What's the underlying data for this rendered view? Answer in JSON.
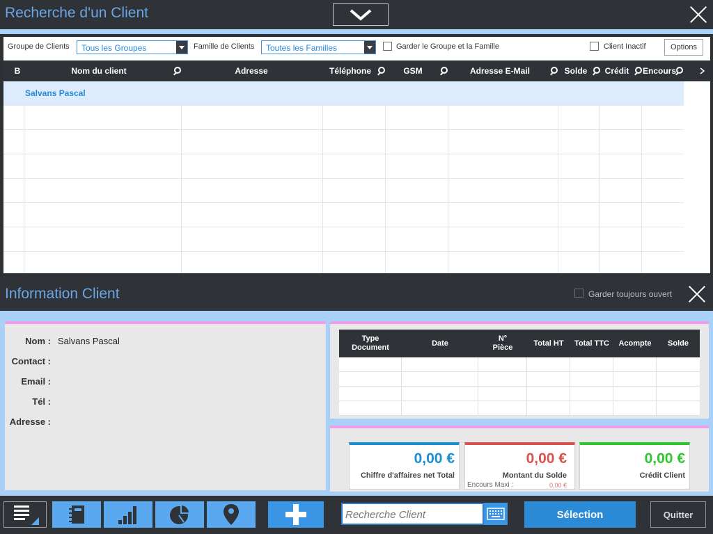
{
  "window": {
    "title": "Recherche d'un Client"
  },
  "filters": {
    "group_label": "Groupe de Clients",
    "group_value": "Tous les Groupes",
    "family_label": "Famille de Clients",
    "family_value": "Toutes les Familles",
    "keep_label": "Garder le Groupe et la Famille",
    "inactive_label": "Client Inactif",
    "options_label": "Options"
  },
  "table": {
    "columns": [
      "B",
      "Nom du client",
      "Adresse",
      "Téléphone",
      "GSM",
      "Adresse E-Mail",
      "Solde",
      "Crédit",
      "Encours"
    ],
    "rows": [
      {
        "name": "Salvans Pascal"
      }
    ]
  },
  "info": {
    "title": "Information Client",
    "keep_open_label": "Garder toujours ouvert",
    "fields": [
      {
        "label": "Nom :",
        "value": "Salvans Pascal"
      },
      {
        "label": "Contact :",
        "value": ""
      },
      {
        "label": "Email :",
        "value": ""
      },
      {
        "label": "Tél :",
        "value": ""
      },
      {
        "label": "Adresse :",
        "value": ""
      }
    ],
    "doc_columns": [
      "Type Document",
      "Date",
      "N° Pièce",
      "Total HT",
      "Total TTC",
      "Acompte",
      "Solde"
    ]
  },
  "totals": {
    "ca_value": "0,00 €",
    "ca_label": "Chiffre d'affaires net Total",
    "solde_value": "0,00 €",
    "solde_label": "Montant du Solde",
    "encours_label": "Encours Maxi :",
    "encours_value": "0,00 €",
    "credit_value": "0,00 €",
    "credit_label": "Crédit Client"
  },
  "colors": {
    "blue": "#1b8fd0",
    "red": "#d9534f",
    "green": "#2ec52e",
    "pink": "#f09ee8"
  },
  "toolbar": {
    "icons": [
      "list-settings-icon",
      "notebook-icon",
      "bar-chart-icon",
      "pie-chart-icon",
      "location-pin-icon",
      "add-icon",
      "keyboard-icon"
    ],
    "search_placeholder": "Recherche Client",
    "select_label": "Sélection",
    "quit_label": "Quitter"
  }
}
